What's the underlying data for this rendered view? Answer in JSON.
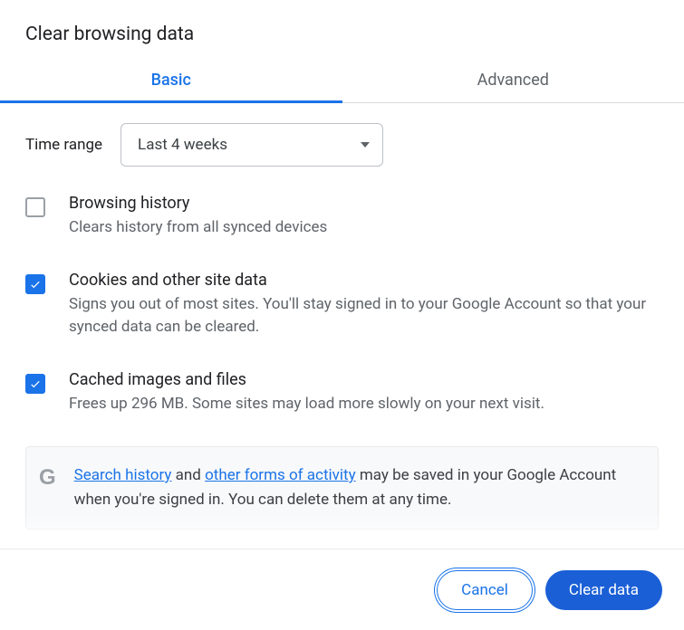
{
  "title": "Clear browsing data",
  "tabs": {
    "basic": "Basic",
    "advanced": "Advanced"
  },
  "time_range": {
    "label": "Time range",
    "value": "Last 4 weeks"
  },
  "options": {
    "history": {
      "checked": false,
      "title": "Browsing history",
      "desc": "Clears history from all synced devices"
    },
    "cookies": {
      "checked": true,
      "title": "Cookies and other site data",
      "desc": "Signs you out of most sites. You'll stay signed in to your Google Account so that your synced data can be cleared."
    },
    "cache": {
      "checked": true,
      "title": "Cached images and files",
      "desc": "Frees up 296 MB. Some sites may load more slowly on your next visit."
    }
  },
  "info": {
    "link_search": "Search history",
    "mid1": " and ",
    "link_activity": "other forms of activity",
    "tail": " may be saved in your Google Account when you're signed in. You can delete them at any time."
  },
  "buttons": {
    "cancel": "Cancel",
    "clear": "Clear data"
  }
}
